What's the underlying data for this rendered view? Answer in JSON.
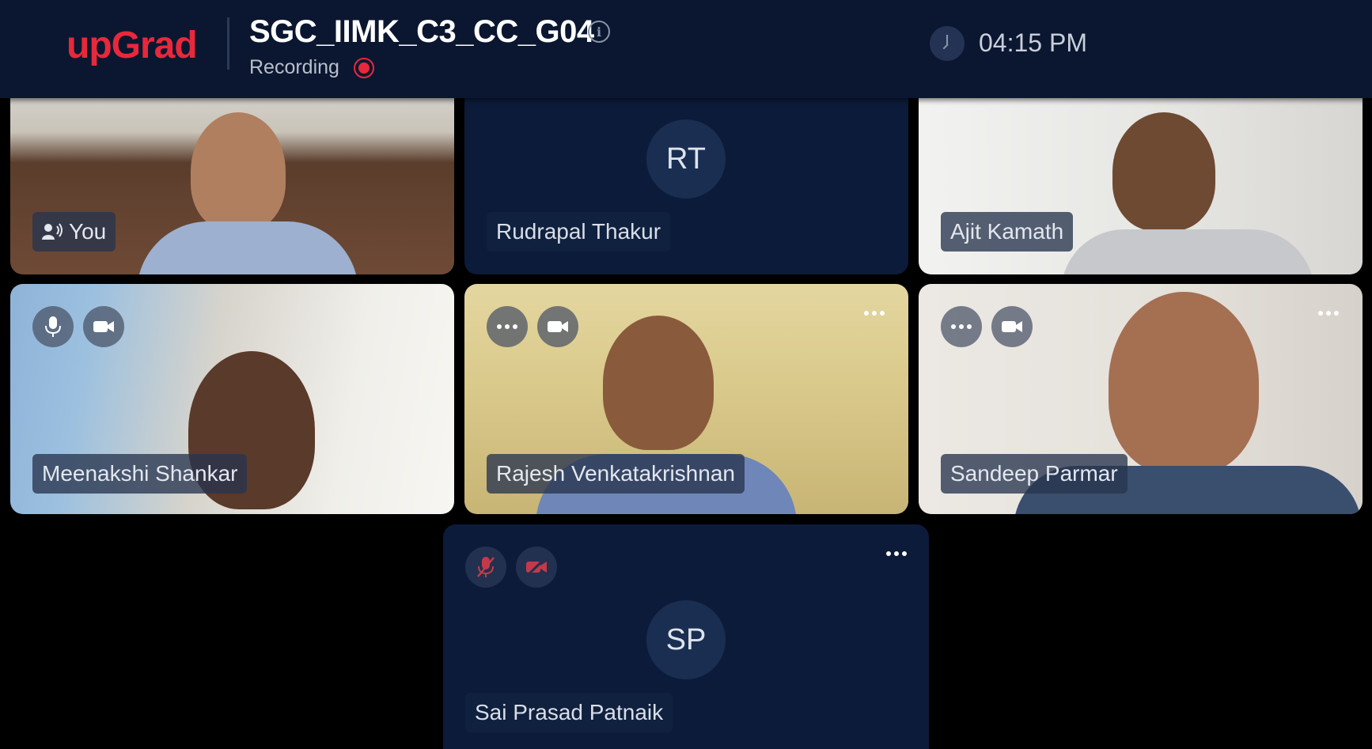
{
  "header": {
    "logo": "upGrad",
    "meeting_title": "SGC_IIMK_C3_CC_G04",
    "recording_label": "Recording",
    "time": "04:15 PM"
  },
  "participants": [
    {
      "name": "You",
      "initials": "",
      "video": true,
      "speaking": true
    },
    {
      "name": "Rudrapal Thakur",
      "initials": "RT",
      "video": false
    },
    {
      "name": "Ajit Kamath",
      "initials": "",
      "video": true
    },
    {
      "name": "Meenakshi Shankar",
      "initials": "",
      "video": true
    },
    {
      "name": "Rajesh Venkatakrishnan",
      "initials": "",
      "video": true
    },
    {
      "name": "Sandeep Parmar",
      "initials": "",
      "video": true
    },
    {
      "name": "Sai Prasad Patnaik",
      "initials": "SP",
      "video": false,
      "mic_muted": true,
      "cam_off": true
    }
  ],
  "icons": {
    "info": "info-icon",
    "recording": "recording-dot-icon",
    "clock": "clock-icon",
    "speaker": "speaker-icon",
    "mic": "microphone-icon",
    "camera": "camera-icon",
    "more": "more-options-icon"
  },
  "colors": {
    "brand": "#e8283b",
    "header_bg": "#0b1730",
    "tile_dark": "#0c1b3a"
  }
}
